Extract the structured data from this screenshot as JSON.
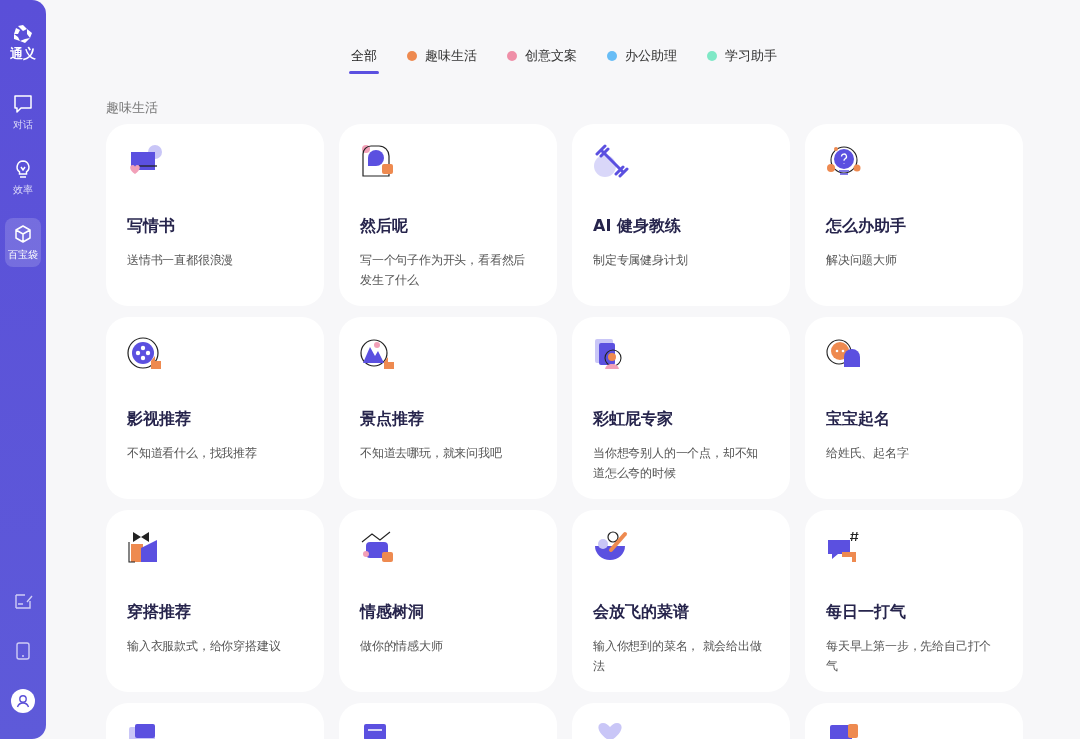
{
  "sidebar": {
    "logo_text": "通义",
    "items": [
      {
        "label": "对话",
        "selected": false
      },
      {
        "label": "效率",
        "selected": false
      },
      {
        "label": "百宝袋",
        "selected": true
      }
    ]
  },
  "tabs": [
    {
      "label": "全部",
      "selected": true
    },
    {
      "label": "趣味生活",
      "selected": false,
      "color": "#ee8a50"
    },
    {
      "label": "创意文案",
      "selected": false,
      "color": "#ef8fa8"
    },
    {
      "label": "办公助理",
      "selected": false,
      "color": "#68bdf6"
    },
    {
      "label": "学习助手",
      "selected": false,
      "color": "#7fe8c6"
    }
  ],
  "section_title": "趣味生活",
  "cards": [
    {
      "kind": "full",
      "title": "写情书",
      "description": "送情书一直都很浪漫"
    },
    {
      "kind": "full",
      "title": "然后呢",
      "description": "写一个句子作为开头，看看然后发生了什么"
    },
    {
      "kind": "full",
      "title": "AI 健身教练",
      "description": "制定专属健身计划"
    },
    {
      "kind": "full",
      "title": "怎么办助手",
      "description": "解决问题大师"
    },
    {
      "kind": "full",
      "title": "影视推荐",
      "description": "不知道看什么，找我推荐"
    },
    {
      "kind": "full",
      "title": "景点推荐",
      "description": "不知道去哪玩，就来问我吧"
    },
    {
      "kind": "full",
      "title": "彩虹屁专家",
      "description": "当你想夸别人的一个点，却不知道怎么夸的时候"
    },
    {
      "kind": "full",
      "title": "宝宝起名",
      "description": "给姓氏、起名字"
    },
    {
      "kind": "full",
      "title": "穿搭推荐",
      "description": "输入衣服款式，给你穿搭建议"
    },
    {
      "kind": "full",
      "title": "情感树洞",
      "description": "做你的情感大师"
    },
    {
      "kind": "full",
      "title": "会放飞的菜谱",
      "description": "输入你想到的菜名， 就会给出做法"
    },
    {
      "kind": "full",
      "title": "每日一打气",
      "description": "每天早上第一步，先给自己打个气"
    },
    {
      "kind": "cut_off"
    },
    {
      "kind": "cut_off"
    },
    {
      "kind": "cut_off"
    },
    {
      "kind": "cut_off"
    }
  ]
}
